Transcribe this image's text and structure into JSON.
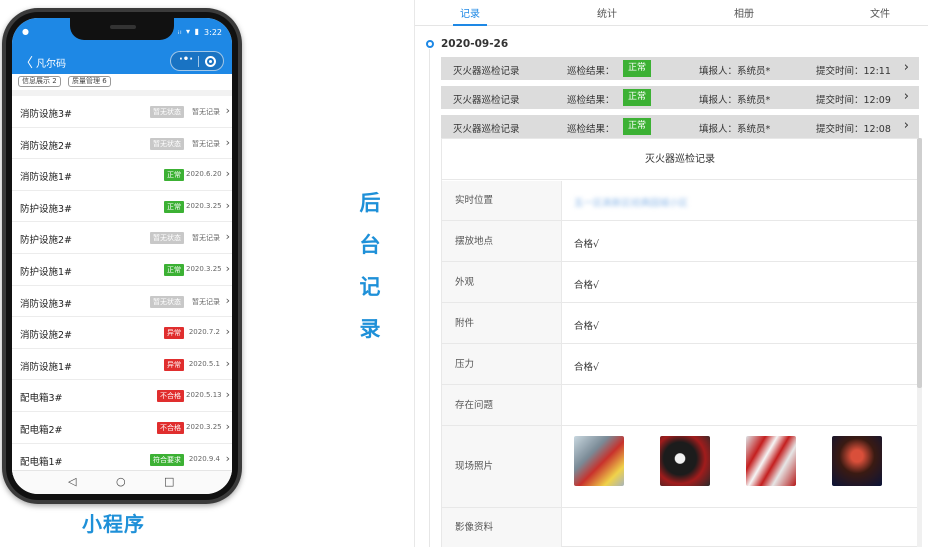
{
  "phone": {
    "status_time": "3:22",
    "status_icons": "ᵢₗ ▾ ▮",
    "status_left": "●",
    "nav_back": "〈",
    "nav_title": "凡尔码",
    "capsule_dots": "·•·",
    "chips": [
      "信息展示 2",
      "质量管理 6"
    ],
    "items": [
      {
        "name": "消防设施3#",
        "status": "暂无状态",
        "status_color": "#c8c8c8",
        "date": "暂无记录"
      },
      {
        "name": "消防设施2#",
        "status": "暂无状态",
        "status_color": "#c8c8c8",
        "date": "暂无记录"
      },
      {
        "name": "消防设施1#",
        "status": "正常",
        "status_color": "#3cb134",
        "date": "2020.6.20"
      },
      {
        "name": "防护设施3#",
        "status": "正常",
        "status_color": "#3cb134",
        "date": "2020.3.25"
      },
      {
        "name": "防护设施2#",
        "status": "暂无状态",
        "status_color": "#c8c8c8",
        "date": "暂无记录"
      },
      {
        "name": "防护设施1#",
        "status": "正常",
        "status_color": "#3cb134",
        "date": "2020.3.25"
      },
      {
        "name": "消防设施3#",
        "status": "暂无状态",
        "status_color": "#c8c8c8",
        "date": "暂无记录"
      },
      {
        "name": "消防设施2#",
        "status": "异常",
        "status_color": "#e02e2e",
        "date": "2020.7.2"
      },
      {
        "name": "消防设施1#",
        "status": "异常",
        "status_color": "#e02e2e",
        "date": "2020.5.1"
      },
      {
        "name": "配电箱3#",
        "status": "不合格",
        "status_color": "#e02e2e",
        "date": "2020.5.13"
      },
      {
        "name": "配电箱2#",
        "status": "不合格",
        "status_color": "#e02e2e",
        "date": "2020.3.25"
      },
      {
        "name": "配电箱1#",
        "status": "符合要求",
        "status_color": "#3cb134",
        "date": "2020.9.4"
      }
    ],
    "nav_keys": [
      "◁",
      "○",
      "□"
    ]
  },
  "phone_caption": "小程序",
  "side_caption": [
    "后",
    "台",
    "记",
    "录"
  ],
  "admin": {
    "tabs": [
      {
        "label": "记录",
        "active": true
      },
      {
        "label": "统计",
        "active": false
      },
      {
        "label": "相册",
        "active": false
      },
      {
        "label": "文件",
        "active": false
      }
    ],
    "date": "2020-09-26",
    "records": [
      {
        "title": "灭火器巡检记录",
        "result_label": "巡检结果：",
        "result": "正常",
        "reporter": "填报人：系统员*",
        "time": "提交时间：12:11"
      },
      {
        "title": "灭火器巡检记录",
        "result_label": "巡检结果：",
        "result": "正常",
        "reporter": "填报人：系统员*",
        "time": "提交时间：12:09"
      },
      {
        "title": "灭火器巡检记录",
        "result_label": "巡检结果：",
        "result": "正常",
        "reporter": "填报人：系统员*",
        "time": "提交时间：12:08"
      }
    ],
    "detail": {
      "title": "灭火器巡检记录",
      "rows": [
        {
          "label": "实时位置",
          "value": "五一区高新区经典园城小区"
        },
        {
          "label": "摆放地点",
          "value": "合格√"
        },
        {
          "label": "外观",
          "value": "合格√"
        },
        {
          "label": "附件",
          "value": "合格√"
        },
        {
          "label": "压力",
          "value": "合格√"
        },
        {
          "label": "存在问题",
          "value": ""
        },
        {
          "label": "现场照片",
          "value": ""
        },
        {
          "label": "影像资料",
          "value": ""
        }
      ]
    },
    "accent": "#1e88e5",
    "ok_color": "#3cb134"
  }
}
